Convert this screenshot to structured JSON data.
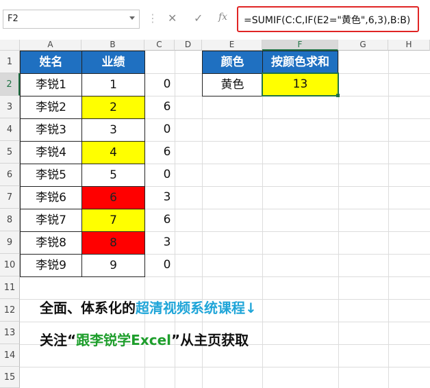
{
  "name_box": {
    "value": "F2"
  },
  "formula_toolbar": {
    "cancel_glyph": "✕",
    "enter_glyph": "✓",
    "fx_glyph": "fx"
  },
  "formula": "=SUMIF(C:C,IF(E2=\"黄色\",6,3),B:B)",
  "columns": [
    "A",
    "B",
    "C",
    "D",
    "E",
    "F",
    "G",
    "H"
  ],
  "rows": [
    "1",
    "2",
    "3",
    "4",
    "5",
    "6",
    "7",
    "8",
    "9",
    "10",
    "11",
    "12",
    "13",
    "14",
    "15"
  ],
  "table": {
    "headers": [
      "姓名",
      "业绩"
    ],
    "names": [
      "李锐1",
      "李锐2",
      "李锐3",
      "李锐4",
      "李锐5",
      "李锐6",
      "李锐7",
      "李锐8",
      "李锐9"
    ],
    "scores": [
      "1",
      "2",
      "3",
      "4",
      "5",
      "6",
      "7",
      "8",
      "9"
    ],
    "score_fill": [
      "none",
      "yellow",
      "none",
      "yellow",
      "none",
      "red",
      "yellow",
      "red",
      "none"
    ],
    "col_c": [
      "0",
      "6",
      "0",
      "6",
      "0",
      "3",
      "6",
      "3",
      "0"
    ]
  },
  "lookup": {
    "header_color": "颜色",
    "header_sum": "按颜色求和",
    "color_value": "黄色",
    "sum_value": "13"
  },
  "promo": {
    "line1_prefix": "全面、体系化的",
    "line1_highlight": "超清视频系统课程↓",
    "line2_prefix": "关注“",
    "line2_highlight": "跟李锐学Excel",
    "line2_suffix": "”从主页获取"
  },
  "colors": {
    "header_blue": "#1f70c1",
    "yellow": "#ffff00",
    "red": "#ff0000",
    "highlight_cyan": "#1fa5d8",
    "highlight_green": "#1e9e2c",
    "formula_border": "#e02424"
  }
}
